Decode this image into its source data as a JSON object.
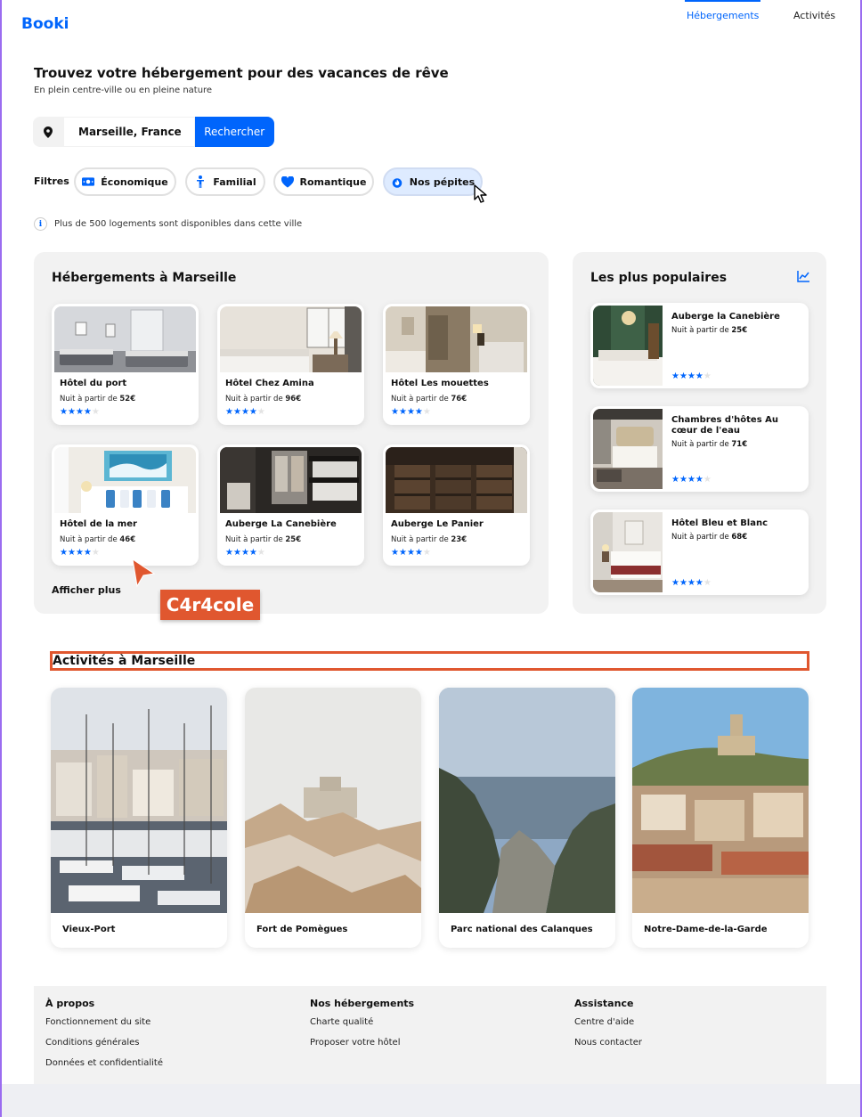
{
  "header": {
    "logo": "Booki",
    "nav": [
      "Hébergements",
      "Activités"
    ]
  },
  "hero": {
    "title": "Trouvez votre hébergement pour des vacances de rêve",
    "subtitle": "En plein centre-ville ou en pleine nature"
  },
  "search": {
    "value": "Marseille, France",
    "button": "Rechercher"
  },
  "filters": {
    "label": "Filtres",
    "chips": [
      {
        "label": "Économique",
        "icon": "money-icon"
      },
      {
        "label": "Familial",
        "icon": "person-icon"
      },
      {
        "label": "Romantique",
        "icon": "heart-icon"
      },
      {
        "label": "Nos pépites",
        "icon": "fire-icon",
        "active": true
      }
    ]
  },
  "info": {
    "icon": "i",
    "text": "Plus de 500 logements sont disponibles dans cette ville"
  },
  "hebergements": {
    "title": "Hébergements à Marseille",
    "price_prefix": "Nuit à partir de",
    "show_more": "Afficher plus",
    "cards": [
      {
        "name": "Hôtel du port",
        "price": "52€",
        "rating": 4
      },
      {
        "name": "Hôtel Chez Amina",
        "price": "96€",
        "rating": 4
      },
      {
        "name": "Hôtel Les mouettes",
        "price": "76€",
        "rating": 4
      },
      {
        "name": "Hôtel de la mer",
        "price": "46€",
        "rating": 4
      },
      {
        "name": "Auberge La Canebière",
        "price": "25€",
        "rating": 4
      },
      {
        "name": "Auberge Le Panier",
        "price": "23€",
        "rating": 4
      }
    ]
  },
  "populaires": {
    "title": "Les plus populaires",
    "cards": [
      {
        "name": "Auberge la Canebière",
        "price": "25€",
        "rating": 4
      },
      {
        "name": "Chambres d'hôtes Au cœur de l'eau",
        "price": "71€",
        "rating": 4
      },
      {
        "name": "Hôtel Bleu et Blanc",
        "price": "68€",
        "rating": 4
      }
    ]
  },
  "annotation": {
    "label": "C4r4cole",
    "color": "#e0572f"
  },
  "activites": {
    "title": "Activités à Marseille",
    "cards": [
      "Vieux-Port",
      "Fort de Pomègues",
      "Parc national des Calanques",
      "Notre-Dame-de-la-Garde"
    ]
  },
  "footer": {
    "columns": [
      {
        "title": "À propos",
        "links": [
          "Fonctionnement du site",
          "Conditions générales",
          "Données et confidentialité"
        ]
      },
      {
        "title": "Nos hébergements",
        "links": [
          "Charte qualité",
          "Proposer votre hôtel"
        ]
      },
      {
        "title": "Assistance",
        "links": [
          "Centre d'aide",
          "Nous contacter"
        ]
      }
    ]
  },
  "colors": {
    "primary": "#0065fc",
    "chip_active": "#deebff",
    "panel": "#f2f2f2"
  }
}
